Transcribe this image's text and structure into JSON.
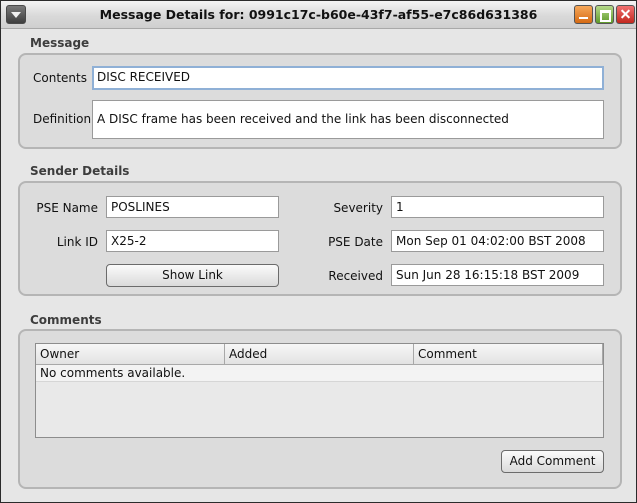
{
  "window": {
    "title": "Message Details for: 0991c17c-b60e-43f7-af55-e7c86d631386",
    "controls": [
      "system-menu",
      "minimize",
      "maximize",
      "close"
    ]
  },
  "message": {
    "section_title": "Message",
    "contents_label": "Contents",
    "contents_value": "DISC RECEIVED",
    "definition_label": "Definition",
    "definition_value": "A DISC frame has been received and the link has been disconnected"
  },
  "sender": {
    "section_title": "Sender Details",
    "pse_name_label": "PSE Name",
    "pse_name_value": "POSLINES",
    "link_id_label": "Link ID",
    "link_id_value": "X25-2",
    "show_link_label": "Show Link",
    "severity_label": "Severity",
    "severity_value": "1",
    "pse_date_label": "PSE Date",
    "pse_date_value": "Mon Sep 01 04:02:00 BST 2008",
    "received_label": "Received",
    "received_value": "Sun Jun 28 16:15:18 BST 2009"
  },
  "comments": {
    "section_title": "Comments",
    "columns": [
      "Owner",
      "Added",
      "Comment"
    ],
    "empty_text": "No comments available.",
    "add_button_label": "Add Comment"
  },
  "colors": {
    "window_bg": "#e6e6e6",
    "panel_bg": "#dcdcdc",
    "focus_border": "#8fb0d6",
    "close_button": "#c2281e",
    "minimize_button": "#d56a14",
    "maximize_button": "#5e9a2a"
  }
}
